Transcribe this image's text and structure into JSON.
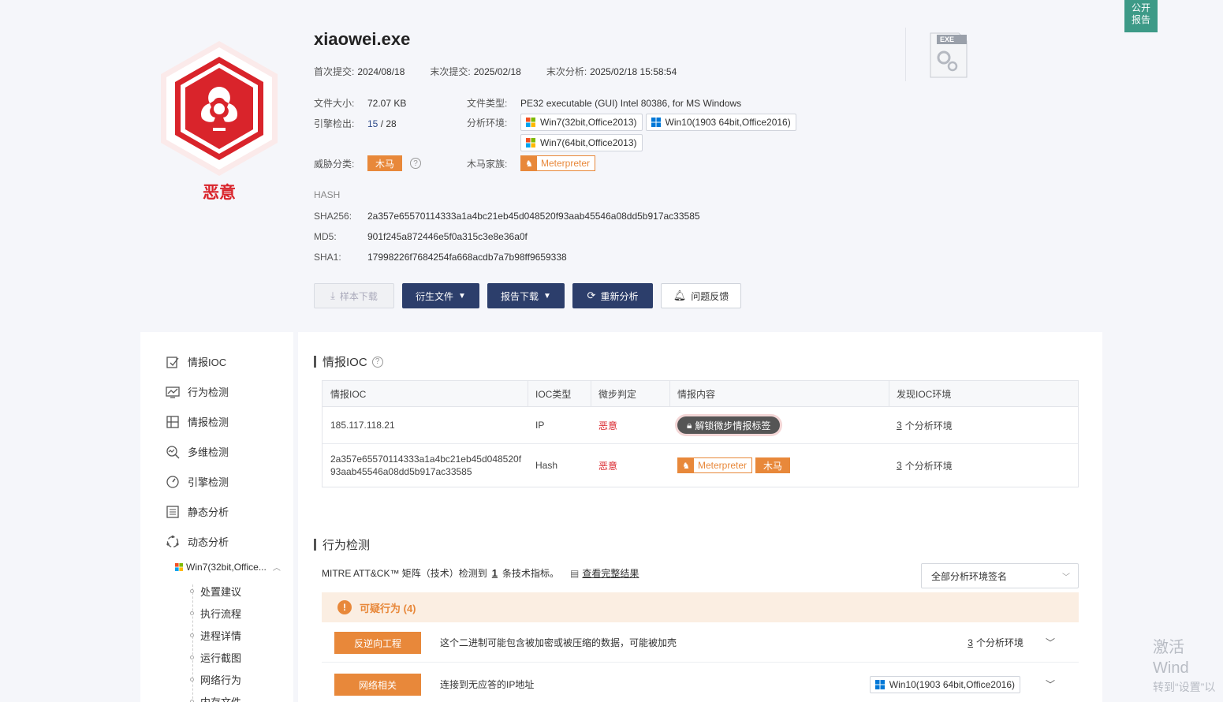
{
  "public_report": "公开\n报告",
  "verdict": "恶意",
  "file": {
    "name": "xiaowei.exe",
    "first_submit_label": "首次提交:",
    "first_submit": "2024/08/18",
    "last_submit_label": "末次提交:",
    "last_submit": "2025/02/18",
    "last_analysis_label": "末次分析:",
    "last_analysis": "2025/02/18 15:58:54",
    "size_label": "文件大小:",
    "size": "72.07 KB",
    "type_label": "文件类型:",
    "type": "PE32 executable (GUI) Intel 80386, for MS Windows",
    "engine_label": "引擎检出:",
    "engine_hits": "15",
    "engine_sep": " / ",
    "engine_total": "28",
    "env_label": "分析环境:",
    "envs": [
      "Win7(32bit,Office2013)",
      "Win10(1903 64bit,Office2016)",
      "Win7(64bit,Office2013)"
    ],
    "threat_label": "威胁分类:",
    "threat": "木马",
    "family_label": "木马家族:",
    "family": "Meterpreter",
    "file_icon_label": "EXE"
  },
  "hash": {
    "heading": "HASH",
    "sha256_label": "SHA256:",
    "sha256": "2a357e65570114333a1a4bc21eb45d048520f93aab45546a08dd5b917ac33585",
    "md5_label": "MD5:",
    "md5": "901f245a872446e5f0a315c3e8e36a0f",
    "sha1_label": "SHA1:",
    "sha1": "17998226f7684254fa668acdb7a7b98ff9659338"
  },
  "actions": {
    "download": "样本下载",
    "derived": "衍生文件",
    "report": "报告下载",
    "reanalyze": "重新分析",
    "feedback": "问题反馈"
  },
  "sidebar": {
    "items": [
      "情报IOC",
      "行为检测",
      "情报检测",
      "多维检测",
      "引擎检测",
      "静态分析",
      "动态分析"
    ],
    "sub_env": "Win7(32bit,Office...",
    "sub_items": [
      "处置建议",
      "执行流程",
      "进程详情",
      "运行截图",
      "网络行为",
      "内存文件"
    ]
  },
  "ioc": {
    "title": "情报IOC",
    "headers": [
      "情报IOC",
      "IOC类型",
      "微步判定",
      "情报内容",
      "发现IOC环境"
    ],
    "rows": [
      {
        "ioc": "185.117.118.21",
        "type": "IP",
        "verdict": "恶意",
        "content": "解锁微步情报标签",
        "env_count": "3",
        "env_suffix": "个分析环境"
      },
      {
        "ioc_line1": "2a357e65570114333a1a4bc21eb45d048520f",
        "ioc_line2": "93aab45546a08dd5b917ac33585",
        "type": "Hash",
        "verdict": "恶意",
        "family": "Meterpreter",
        "threat": "木马",
        "env_count": "3",
        "env_suffix": "个分析环境"
      }
    ]
  },
  "behavior": {
    "title": "行为检测",
    "mitre_prefix": "MITRE ATT&CK™ 矩阵（技术）检测到",
    "mitre_count": "1",
    "mitre_suffix": "条技术指标。",
    "view_full": "查看完整结果",
    "filter": "全部分析环境签名",
    "suspicious": "可疑行为 (4)",
    "rows": [
      {
        "tag": "反逆向工程",
        "desc": "这个二进制可能包含被加密或被压缩的数据，可能被加壳",
        "env_count": "3",
        "env_suffix": "个分析环境"
      },
      {
        "tag": "网络相关",
        "desc": "连接到无应答的IP地址",
        "env": "Win10(1903 64bit,Office2016)"
      }
    ]
  },
  "watermark": {
    "line1": "激活 Wind",
    "line2": "转到“设置”以"
  },
  "colors": {
    "malicious": "#d9242b",
    "accent_orange": "#e8883a",
    "button_dark": "#2c3e6b",
    "teal": "#3d9a87"
  }
}
